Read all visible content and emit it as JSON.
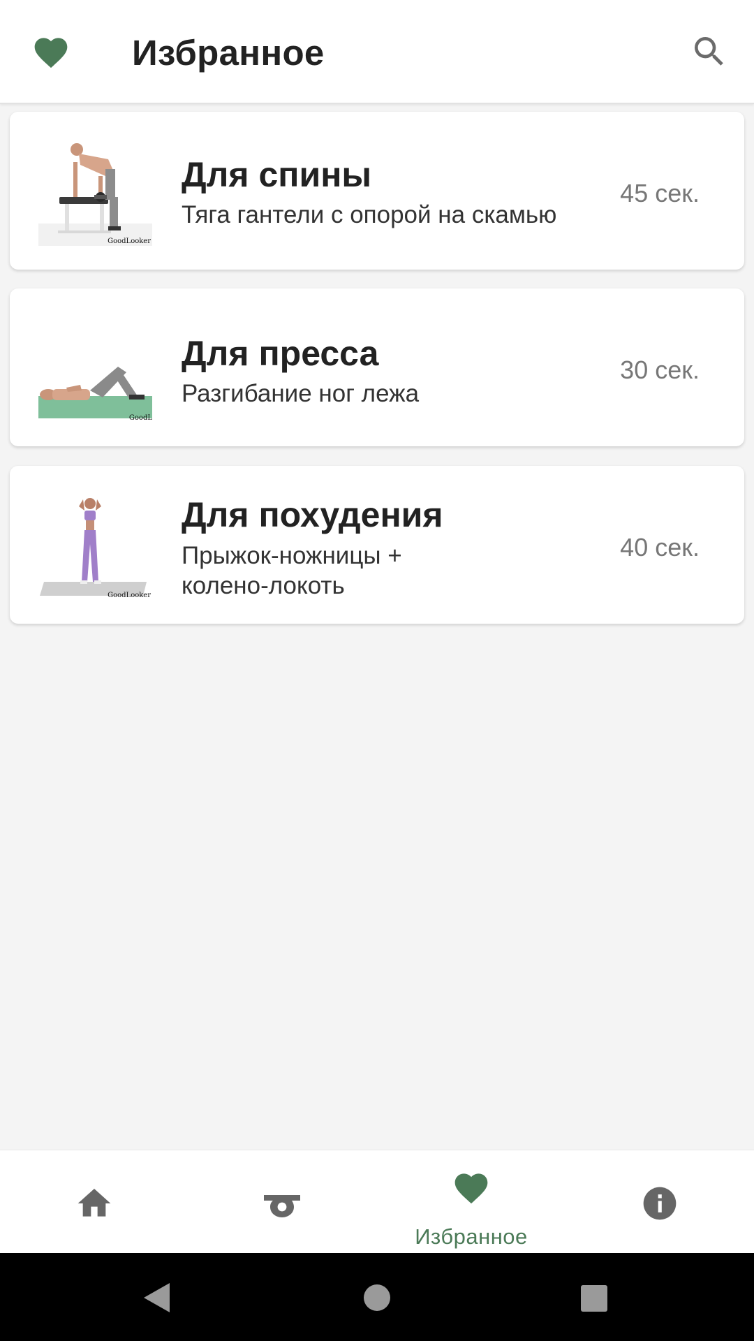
{
  "appbar": {
    "title": "Избранное",
    "left_icon": "heart-icon",
    "right_icon": "search-icon"
  },
  "favorites": [
    {
      "title": "Для спины",
      "subtitle": "Тяга гантели с опорой на скамью",
      "duration": "45 сек.",
      "image_watermark": "GoodLooker"
    },
    {
      "title": "Для пресса",
      "subtitle": "Разгибание ног лежа",
      "duration": "30 сек.",
      "image_watermark": "GoodL"
    },
    {
      "title": "Для похудения",
      "subtitle": "Прыжок-ножницы + колено-локоть",
      "duration": "40 сек.",
      "image_watermark": "GoodLooker"
    }
  ],
  "bottom_nav": {
    "items": [
      {
        "icon": "home-icon",
        "label": "",
        "active": false
      },
      {
        "icon": "whistle-icon",
        "label": "",
        "active": false
      },
      {
        "icon": "heart-icon",
        "label": "Избранное",
        "active": true
      },
      {
        "icon": "info-icon",
        "label": "",
        "active": false
      }
    ]
  },
  "colors": {
    "accent": "#4b7a57",
    "icon_gray": "#666666",
    "background": "#f4f4f4"
  },
  "system_nav": [
    "back-icon",
    "home-circle-icon",
    "recents-icon"
  ]
}
